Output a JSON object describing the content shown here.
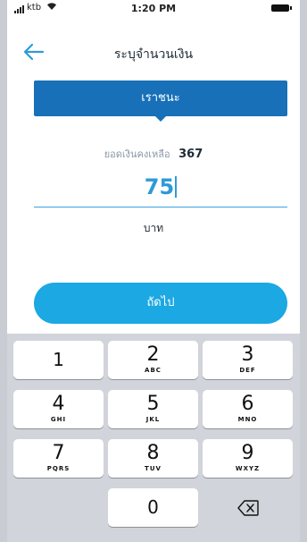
{
  "status_bar": {
    "carrier": "ktb",
    "time": "1:20 PM"
  },
  "header": {
    "title": "ระบุจำนวนเงิน"
  },
  "account": {
    "name": "เราชนะ"
  },
  "balance": {
    "label": "ยอดเงินคงเหลือ",
    "value": "367"
  },
  "amount": {
    "value": "75",
    "unit": "บาท"
  },
  "next_button": {
    "label": "ถัดไป"
  },
  "keypad": {
    "keys": [
      {
        "digit": "1",
        "letters": ""
      },
      {
        "digit": "2",
        "letters": "ABC"
      },
      {
        "digit": "3",
        "letters": "DEF"
      },
      {
        "digit": "4",
        "letters": "GHI"
      },
      {
        "digit": "5",
        "letters": "JKL"
      },
      {
        "digit": "6",
        "letters": "MNO"
      },
      {
        "digit": "7",
        "letters": "PQRS"
      },
      {
        "digit": "8",
        "letters": "TUV"
      },
      {
        "digit": "9",
        "letters": "WXYZ"
      },
      {
        "digit": "0",
        "letters": ""
      }
    ]
  },
  "icons": {
    "back": "arrow-left-icon",
    "delete": "backspace-icon",
    "signal": "signal-icon",
    "wifi": "wifi-icon",
    "battery": "battery-icon"
  },
  "colors": {
    "primary_blue": "#1770b8",
    "button_blue": "#1ba8e3",
    "amount_blue": "#2e9ad8",
    "keypad_bg": "#d1d4da"
  }
}
